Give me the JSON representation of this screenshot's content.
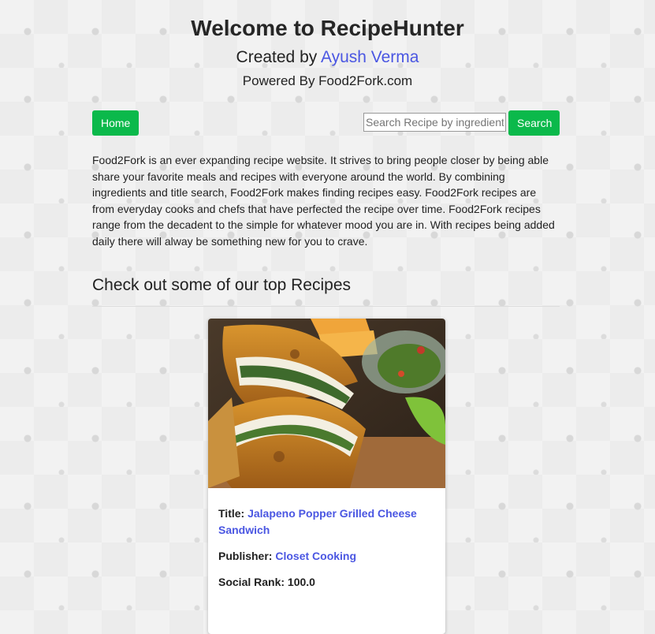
{
  "header": {
    "title": "Welcome to RecipeHunter",
    "created_prefix": "Created by",
    "author": "Ayush Verma",
    "powered": "Powered By Food2Fork.com"
  },
  "nav": {
    "home_label": "Home",
    "search_placeholder": "Search Recipe by ingredient",
    "search_label": "Search"
  },
  "intro": "Food2Fork is an ever expanding recipe website. It strives to bring people closer by being able share your favorite meals and recipes with everyone around the world. By combining ingredients and title search, Food2Fork makes finding recipes easy. Food2Fork recipes are from everyday cooks and chefs that have perfected the recipe over time. Food2Fork recipes range from the decadent to the simple for whatever mood you are in. With recipes being added daily there will alway be something new for you to crave.",
  "section": {
    "title": "Check out some of our top Recipes"
  },
  "recipe": {
    "title_label": "Title:",
    "title": "Jalapeno Popper Grilled Cheese Sandwich",
    "publisher_label": "Publisher:",
    "publisher": "Closet Cooking",
    "rank_label": "Social Rank:",
    "rank": "100.0"
  },
  "colors": {
    "accent": "#0bb94b",
    "link": "#4a56e2"
  }
}
